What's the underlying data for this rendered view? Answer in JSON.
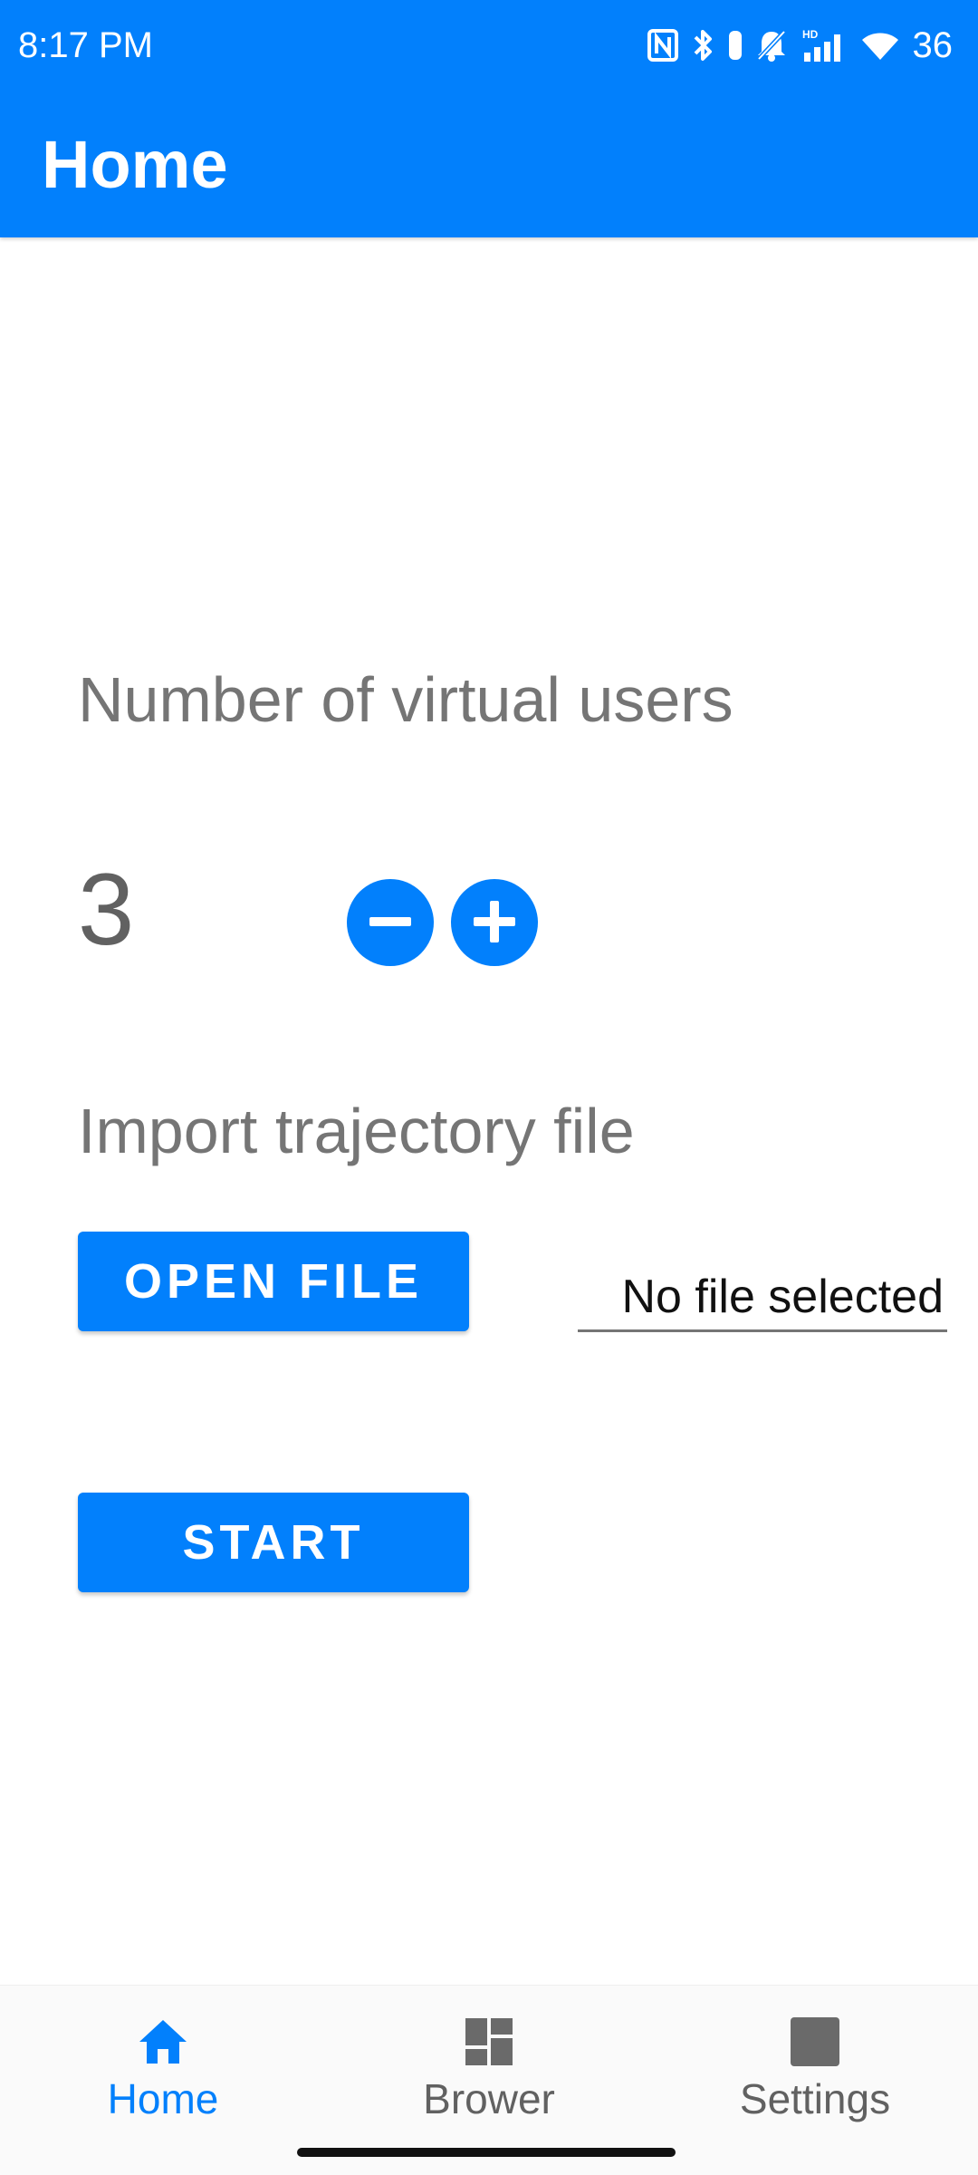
{
  "status_bar": {
    "time": "8:17 PM",
    "battery": "36"
  },
  "app_bar": {
    "title": "Home"
  },
  "users": {
    "label": "Number of virtual users",
    "count": "3",
    "decrement_icon": "minus-circle-icon",
    "increment_icon": "plus-circle-icon"
  },
  "trajectory": {
    "label": "Import trajectory file",
    "open_file_label": "OPEN FILE",
    "file_status": "No file selected"
  },
  "actions": {
    "start_label": "START"
  },
  "bottom_nav": {
    "items": [
      {
        "label": "Home",
        "icon": "home-icon",
        "active": true
      },
      {
        "label": "Brower",
        "icon": "dashboard-icon",
        "active": false
      },
      {
        "label": "Settings",
        "icon": "square-icon",
        "active": false
      }
    ]
  },
  "colors": {
    "primary": "#0280FC",
    "label_gray": "#757575",
    "nav_inactive": "#616161"
  }
}
